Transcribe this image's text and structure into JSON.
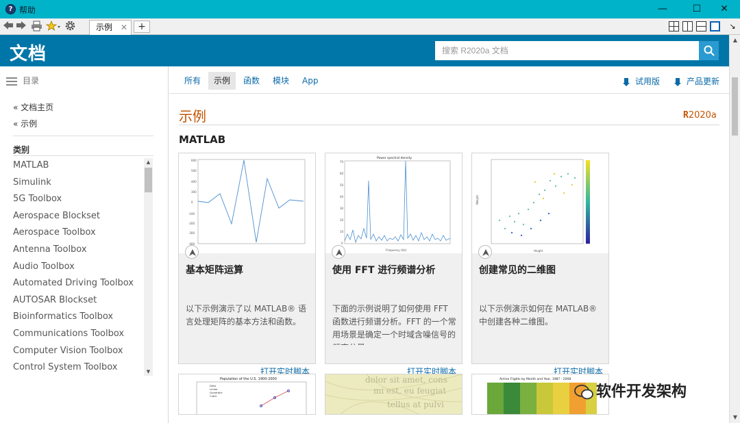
{
  "window": {
    "title": "帮助",
    "app_icon": "?"
  },
  "window_controls": {
    "minimize": "—",
    "maximize": "☐",
    "close": "✕"
  },
  "toolbar": {
    "back_icon": "back-arrow-icon",
    "forward_icon": "forward-arrow-icon",
    "tab_label": "示例",
    "tab_close": "✕",
    "new_tab": "+",
    "dock_icon": "↘"
  },
  "header": {
    "brand": "文档",
    "search_placeholder": "搜索 R2020a 文档"
  },
  "sidebar": {
    "toc_label": "目录",
    "links": [
      "« 文档主页",
      "« 示例"
    ],
    "category_title": "类别",
    "categories": [
      "MATLAB",
      "Simulink",
      "5G Toolbox",
      "Aerospace Blockset",
      "Aerospace Toolbox",
      "Antenna Toolbox",
      "Audio Toolbox",
      "Automated Driving Toolbox",
      "AUTOSAR Blockset",
      "Bioinformatics Toolbox",
      "Communications Toolbox",
      "Computer Vision Toolbox",
      "Control System Toolbox"
    ]
  },
  "nav": {
    "tabs": [
      "所有",
      "示例",
      "函数",
      "模块",
      "App"
    ],
    "selected": "示例",
    "trial": "试用版",
    "updates": "产品更新"
  },
  "main": {
    "title": "示例",
    "release_r": "R",
    "release_rest": "2020a",
    "section": "MATLAB",
    "cards": [
      {
        "title": "基本矩阵运算",
        "description": "以下示例演示了以 MATLAB® 语言处理矩阵的基本方法和函数。",
        "link": "打开实时脚本"
      },
      {
        "title": "使用 FFT 进行频谱分析",
        "description": "下面的示例说明了如何使用 FFT 函数进行频谱分析。FFT 的一个常用场景是确定一个时域含噪信号的频率分量。",
        "link": "打开实时脚本",
        "thumb_title": "Power spectral density",
        "thumb_xlabel": "Frequency (Hz)"
      },
      {
        "title": "创建常见的二维图",
        "description": "以下示例演示如何在 MATLAB® 中创建各种二维图。",
        "link": "打开实时脚本",
        "thumb_xlabel": "Height",
        "thumb_ylabel": "Weight"
      }
    ],
    "row2": [
      {
        "thumb_title": "Population of the U.S. 1900-2000",
        "legend": [
          "Data",
          "Linear",
          "Quadratic",
          "Cubic"
        ]
      },
      {
        "thumb_text": [
          "dolor sit amet, cons",
          "mi est, eu feugiat",
          "tellus at pulvi"
        ]
      },
      {
        "thumb_title": "Airline Flights by Month and Year, 1987 - 2008"
      }
    ]
  },
  "watermark": {
    "text": "软件开发架构"
  },
  "colors": {
    "titlebar": "#00b3c8",
    "header": "#0076a8",
    "link": "#0b6aa8",
    "page_title": "#c45400"
  }
}
